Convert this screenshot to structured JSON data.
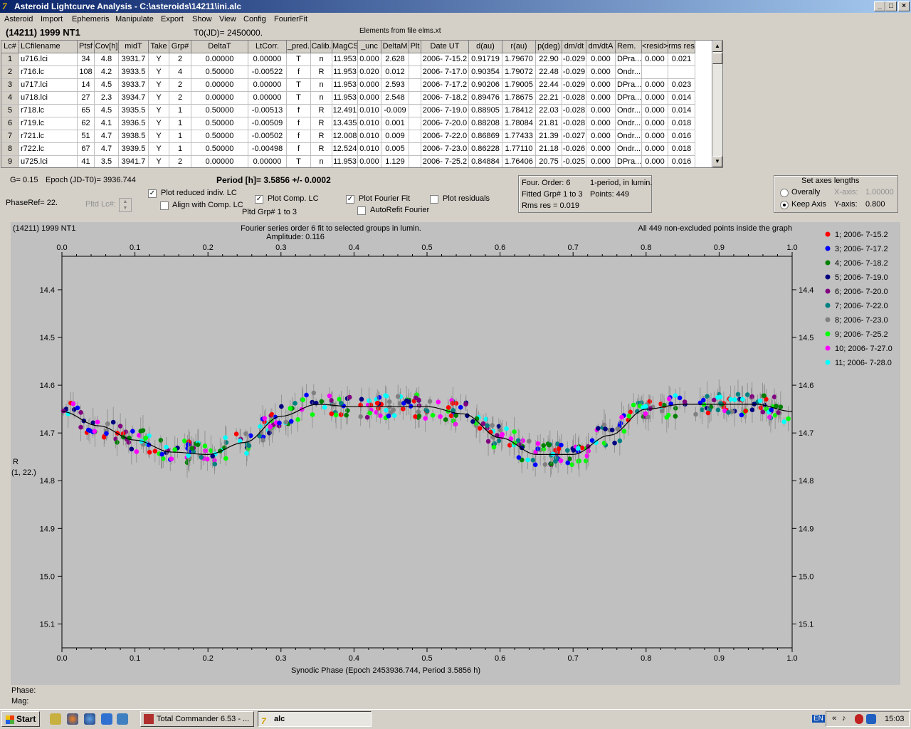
{
  "window": {
    "title": "Asteroid Lightcurve Analysis - C:\\asteroids\\14211\\ini.alc",
    "min": "_",
    "max": "□",
    "close": "×"
  },
  "menu": [
    "Asteroid",
    "Import",
    "Ephemeris",
    "Manipulate",
    "Export",
    "Show",
    "View",
    "Config",
    "FourierFit"
  ],
  "header": {
    "object": "(14211) 1999 NT1",
    "t0": "T0(JD)= 2450000.",
    "elements": "Elements from file elms.xt"
  },
  "table": {
    "columns": [
      "Lc#",
      "LCfilename",
      "Ptsf",
      "Cov[h]",
      "midT",
      "Take",
      "Grp#",
      "DeltaT",
      "LtCorr.",
      "_pred.",
      "Calib.",
      "MagCS",
      "_unc",
      "DeltaM",
      "Plt",
      "Date UT",
      "d(au)",
      "r(au)",
      "p(deg)",
      "dm/dt",
      "dm/dtA",
      "Rem.",
      "<resid>",
      "rms res"
    ],
    "rows": [
      [
        "1",
        "u716.lci",
        "34",
        "4.8",
        "3931.7",
        "Y",
        "2",
        "0.00000",
        "0.00000",
        "T",
        "n",
        "11.953",
        "0.000",
        "2.628",
        "",
        "2006- 7-15.2",
        "0.91719",
        "1.79670",
        "22.90",
        "-0.029",
        "0.000",
        "DPra...",
        "0.000",
        "0.021"
      ],
      [
        "2",
        "r716.lc",
        "108",
        "4.2",
        "3933.5",
        "Y",
        "4",
        "0.50000",
        "-0.00522",
        "f",
        "R",
        "11.953",
        "0.020",
        "0.012",
        "",
        "2006- 7-17.0",
        "0.90354",
        "1.79072",
        "22.48",
        "-0.029",
        "0.000",
        "Ondr...",
        "",
        ""
      ],
      [
        "3",
        "u717.lci",
        "14",
        "4.5",
        "3933.7",
        "Y",
        "2",
        "0.00000",
        "0.00000",
        "T",
        "n",
        "11.953",
        "0.000",
        "2.593",
        "",
        "2006- 7-17.2",
        "0.90206",
        "1.79005",
        "22.44",
        "-0.029",
        "0.000",
        "DPra...",
        "0.000",
        "0.023"
      ],
      [
        "4",
        "u718.lci",
        "27",
        "2.3",
        "3934.7",
        "Y",
        "2",
        "0.00000",
        "0.00000",
        "T",
        "n",
        "11.953",
        "0.000",
        "2.548",
        "",
        "2006- 7-18.2",
        "0.89476",
        "1.78675",
        "22.21",
        "-0.028",
        "0.000",
        "DPra...",
        "0.000",
        "0.014"
      ],
      [
        "5",
        "r718.lc",
        "65",
        "4.5",
        "3935.5",
        "Y",
        "1",
        "0.50000",
        "-0.00513",
        "f",
        "R",
        "12.491",
        "0.010",
        "-0.009",
        "",
        "2006- 7-19.0",
        "0.88905",
        "1.78412",
        "22.03",
        "-0.028",
        "0.000",
        "Ondr...",
        "0.000",
        "0.014"
      ],
      [
        "6",
        "r719.lc",
        "62",
        "4.1",
        "3936.5",
        "Y",
        "1",
        "0.50000",
        "-0.00509",
        "f",
        "R",
        "13.435",
        "0.010",
        "0.001",
        "",
        "2006- 7-20.0",
        "0.88208",
        "1.78084",
        "21.81",
        "-0.028",
        "0.000",
        "Ondr...",
        "0.000",
        "0.018"
      ],
      [
        "7",
        "r721.lc",
        "51",
        "4.7",
        "3938.5",
        "Y",
        "1",
        "0.50000",
        "-0.00502",
        "f",
        "R",
        "12.008",
        "0.010",
        "0.009",
        "",
        "2006- 7-22.0",
        "0.86869",
        "1.77433",
        "21.39",
        "-0.027",
        "0.000",
        "Ondr...",
        "0.000",
        "0.016"
      ],
      [
        "8",
        "r722.lc",
        "67",
        "4.7",
        "3939.5",
        "Y",
        "1",
        "0.50000",
        "-0.00498",
        "f",
        "R",
        "12.524",
        "0.010",
        "0.005",
        "",
        "2006- 7-23.0",
        "0.86228",
        "1.77110",
        "21.18",
        "-0.026",
        "0.000",
        "Ondr...",
        "0.000",
        "0.018"
      ],
      [
        "9",
        "u725.lci",
        "41",
        "3.5",
        "3941.7",
        "Y",
        "2",
        "0.00000",
        "0.00000",
        "T",
        "n",
        "11.953",
        "0.000",
        "1.129",
        "",
        "2006- 7-25.2",
        "0.84884",
        "1.76406",
        "20.75",
        "-0.025",
        "0.000",
        "DPra...",
        "0.000",
        "0.016"
      ]
    ]
  },
  "controls": {
    "g": "G= 0.15",
    "epoch": "Epoch (JD-T0)= 3936.744",
    "period": "Period [h]= 3.5856 +/- 0.0002",
    "phaseref": "PhaseRef= 22.",
    "pltd_lc": "Pltd Lc#:",
    "plot_reduced": "Plot reduced indiv. LC",
    "align_comp": "Align with Comp. LC",
    "plot_comp": "Plot Comp. LC",
    "pltd_grp": "Pltd Grp#  1   to   3",
    "plot_fourier": "Plot Fourier Fit",
    "autorefit": "AutoRefit Fourier",
    "plot_resid": "Plot residuals",
    "checks": {
      "plot_reduced": true,
      "align_comp": false,
      "plot_comp": true,
      "plot_fourier": true,
      "autorefit": false,
      "plot_resid": false
    }
  },
  "fourier_info": {
    "order": "Four. Order:  6",
    "mode": "1-period, in lumin.",
    "fitted": "Fitted Grp# 1 to 3",
    "points": "Points: 449",
    "rms": "Rms res     = 0.019"
  },
  "axes_panel": {
    "title": "Set axes lengths",
    "overally": "Overally",
    "keep": "Keep Axis",
    "xlabel": "X-axis:",
    "xval": "1.00000",
    "ylabel": "Y-axis:",
    "yval": "0.800",
    "selected": "keep"
  },
  "chart_data": {
    "type": "scatter",
    "title": "(14211) 1999 NT1",
    "subtitle": "Fourier series order 6 fit to selected groups in lumin.",
    "amplitude": "Amplitude: 0.116",
    "note": "All 449 non-excluded points inside the graph",
    "xlabel": "Synodic Phase (Epoch 2453936.744, Period 3.5856 h)",
    "ylabel": "R",
    "ylabel2": "(1, 22.)",
    "xlim": [
      0,
      1
    ],
    "ylim": [
      15.15,
      14.33
    ],
    "x_ticks": [
      "0.0",
      "0.1",
      "0.2",
      "0.3",
      "0.4",
      "0.5",
      "0.6",
      "0.7",
      "0.8",
      "0.9",
      "1.0"
    ],
    "y_ticks": [
      "14.4",
      "14.5",
      "14.6",
      "14.7",
      "14.8",
      "14.9",
      "15.0",
      "15.1"
    ],
    "fit": {
      "x": [
        0,
        0.05,
        0.1,
        0.15,
        0.2,
        0.25,
        0.3,
        0.35,
        0.4,
        0.45,
        0.5,
        0.55,
        0.6,
        0.65,
        0.7,
        0.75,
        0.8,
        0.85,
        0.9,
        0.95,
        1.0
      ],
      "y": [
        14.655,
        14.685,
        14.715,
        14.74,
        14.745,
        14.72,
        14.665,
        14.64,
        14.645,
        14.645,
        14.645,
        14.66,
        14.71,
        14.745,
        14.745,
        14.705,
        14.65,
        14.64,
        14.64,
        14.64,
        14.655
      ]
    },
    "series": [
      {
        "name": "1; 2006- 7-15.2",
        "color": "#ff0000"
      },
      {
        "name": "3; 2006- 7-17.2",
        "color": "#0000ff"
      },
      {
        "name": "4; 2006- 7-18.2",
        "color": "#008000"
      },
      {
        "name": "5; 2006- 7-19.0",
        "color": "#000080"
      },
      {
        "name": "6; 2006- 7-20.0",
        "color": "#800080"
      },
      {
        "name": "7; 2006- 7-22.0",
        "color": "#008080"
      },
      {
        "name": "8; 2006- 7-23.0",
        "color": "#808080"
      },
      {
        "name": "9; 2006- 7-25.2",
        "color": "#00ff00"
      },
      {
        "name": "10; 2006- 7-27.0",
        "color": "#ff00ff"
      },
      {
        "name": "11; 2006- 7-28.0",
        "color": "#00ffff"
      }
    ]
  },
  "status": {
    "phase": "Phase:",
    "mag": "Mag:"
  },
  "taskbar": {
    "start": "Start",
    "tasks": [
      "Total Commander 6.53 - ...",
      "alc"
    ],
    "lang": "EN",
    "clock": "15:03"
  }
}
